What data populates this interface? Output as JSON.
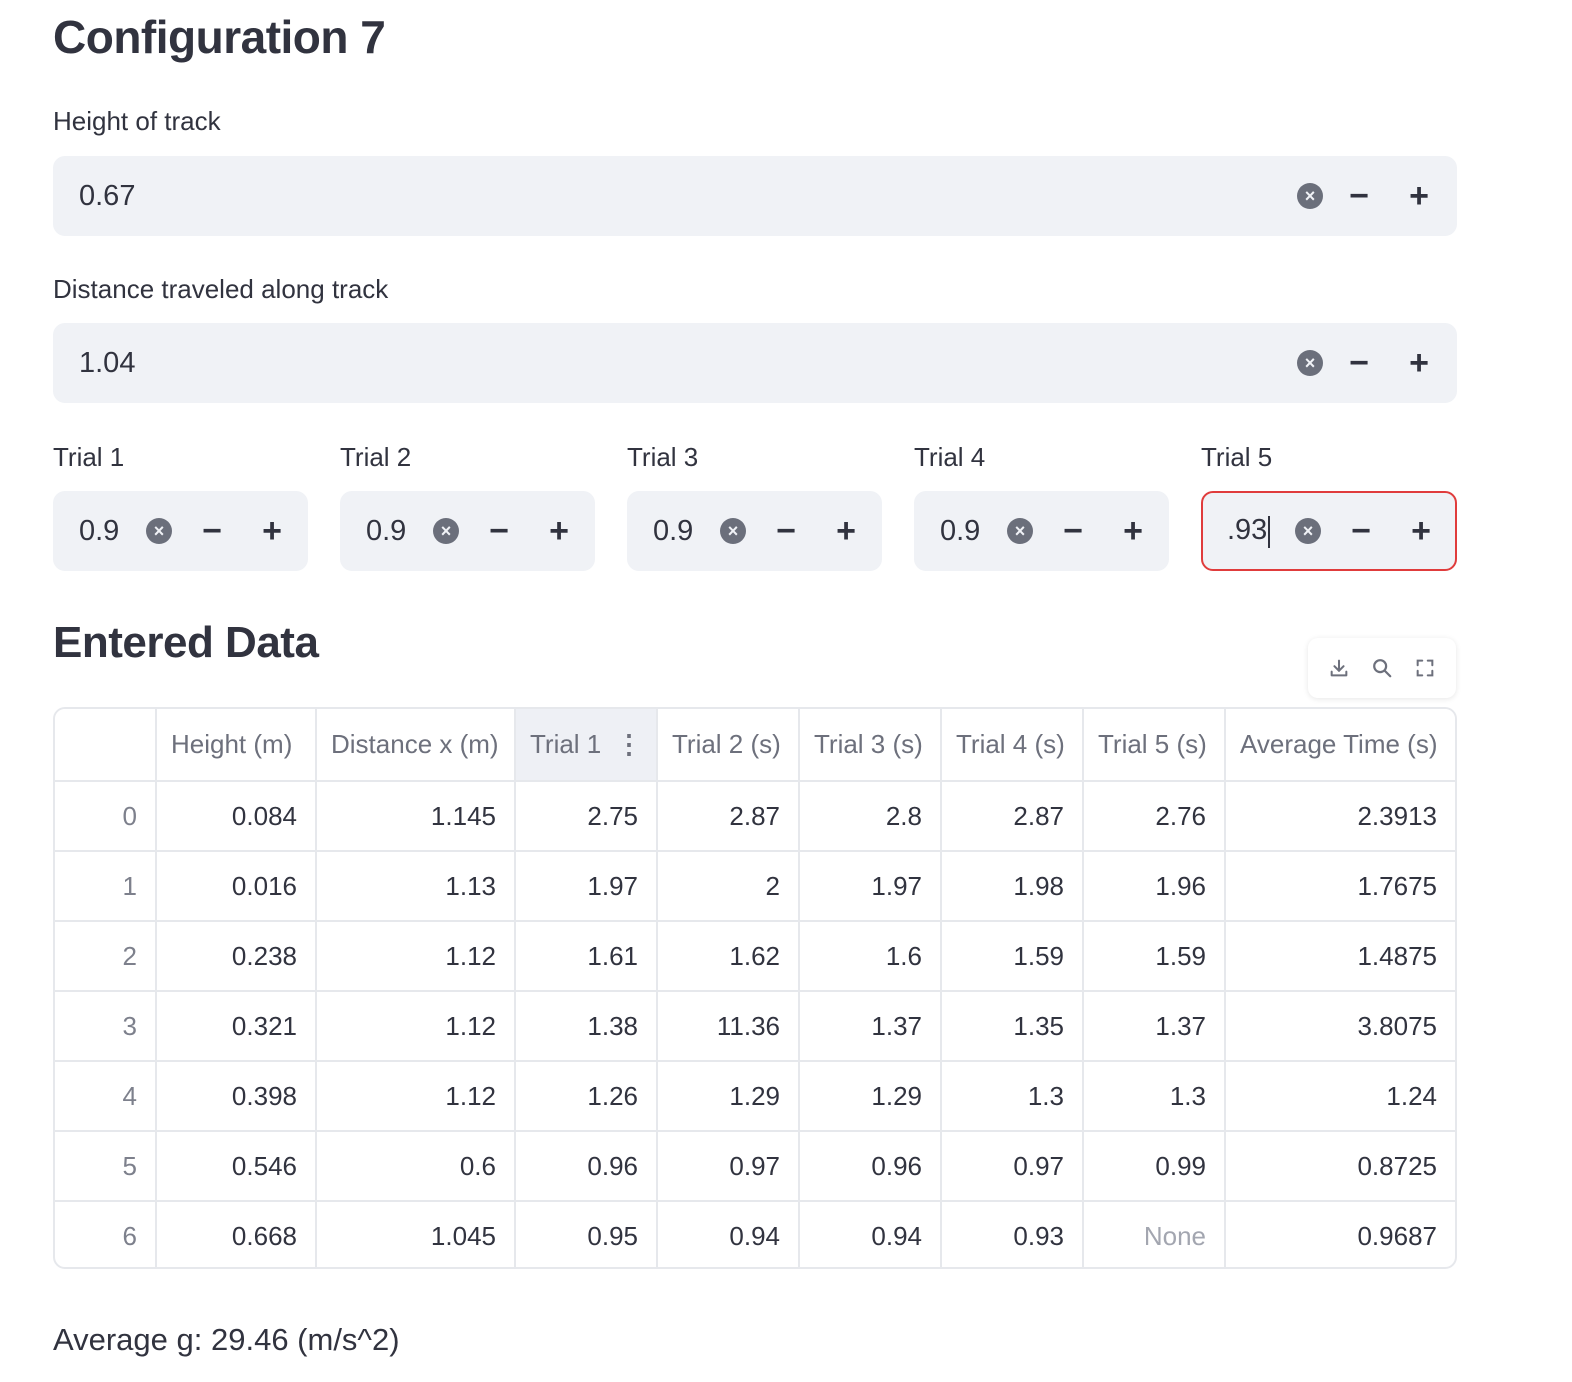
{
  "title": "Configuration 7",
  "height_input": {
    "label": "Height of track",
    "value": "0.67"
  },
  "distance_input": {
    "label": "Distance traveled along track",
    "value": "1.04"
  },
  "trials": [
    {
      "label": "Trial 1",
      "value": "0.9"
    },
    {
      "label": "Trial 2",
      "value": "0.9"
    },
    {
      "label": "Trial 3",
      "value": "0.9"
    },
    {
      "label": "Trial 4",
      "value": "0.9"
    },
    {
      "label": "Trial 5",
      "value": ".93",
      "focused": true
    }
  ],
  "controls": {
    "minus": "−",
    "plus": "+",
    "clear": "×"
  },
  "section_title": "Entered Data",
  "toolbar_icons": [
    "download-icon",
    "search-icon",
    "fullscreen-icon"
  ],
  "table": {
    "columns": [
      "",
      "Height (m)",
      "Distance x (m)",
      "Trial 1",
      "Trial 2 (s)",
      "Trial 3 (s)",
      "Trial 4 (s)",
      "Trial 5 (s)",
      "Average Time (s)"
    ],
    "column_menu": "⋮",
    "rows": [
      [
        "0",
        "0.084",
        "1.145",
        "2.75",
        "2.87",
        "2.8",
        "2.87",
        "2.76",
        "2.3913"
      ],
      [
        "1",
        "0.016",
        "1.13",
        "1.97",
        "2",
        "1.97",
        "1.98",
        "1.96",
        "1.7675"
      ],
      [
        "2",
        "0.238",
        "1.12",
        "1.61",
        "1.62",
        "1.6",
        "1.59",
        "1.59",
        "1.4875"
      ],
      [
        "3",
        "0.321",
        "1.12",
        "1.38",
        "11.36",
        "1.37",
        "1.35",
        "1.37",
        "3.8075"
      ],
      [
        "4",
        "0.398",
        "1.12",
        "1.26",
        "1.29",
        "1.29",
        "1.3",
        "1.3",
        "1.24"
      ],
      [
        "5",
        "0.546",
        "0.6",
        "0.96",
        "0.97",
        "0.96",
        "0.97",
        "0.99",
        "0.8725"
      ],
      [
        "6",
        "0.668",
        "1.045",
        "0.95",
        "0.94",
        "0.94",
        "0.93",
        "None",
        "0.9687"
      ]
    ]
  },
  "average_g": "Average g: 29.46 (m/s^2)",
  "colors": {
    "input_bg": "#f0f2f6",
    "focus_border": "#e03c3c",
    "text": "#31333f",
    "muted": "#6d707c"
  }
}
